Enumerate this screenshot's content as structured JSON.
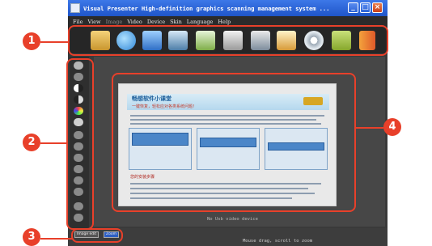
{
  "window": {
    "title": "Visual Presenter High-definition graphics scanning management system  ...",
    "controls": {
      "minimize": "_",
      "maximize": "□",
      "close": "×"
    }
  },
  "menu": [
    "File",
    "View",
    "Image",
    "Video",
    "Device",
    "Skin",
    "Language",
    "Help"
  ],
  "toolbar_icons": [
    "folder-icon",
    "chat-icon",
    "monitor-icon",
    "screen-icon",
    "music-icon",
    "camera-icon",
    "photos-icon",
    "photo-frame-icon",
    "webcam-icon",
    "translate-icon",
    "film-icon"
  ],
  "sidebar_icons": [
    "bulb-icon",
    "bulb-off-icon",
    "contrast-icon",
    "contrast-alt-icon",
    "color-icon",
    "brightness-icon",
    "zoom-icon",
    "crop-icon",
    "rotate-icon",
    "flip-icon",
    "arrow-icon",
    "pen-icon",
    "undo-icon",
    "redo-icon"
  ],
  "canvas": {
    "no_device_text": "No Usb video device"
  },
  "statusbar": {
    "buttons": [
      "Image edit",
      "Zoom"
    ],
    "hint": "Mouse drag, scroll to zoom"
  },
  "document": {
    "title": "畅想软件小课堂",
    "subtitle": "一键恢复，轻松应对各类系统问题！",
    "footer": "您的安装步骤"
  },
  "callouts": [
    "1",
    "2",
    "3",
    "4"
  ],
  "colors": {
    "accent": "#e8402a",
    "titlebar": "#2f66d8",
    "canvas": "#474747"
  }
}
